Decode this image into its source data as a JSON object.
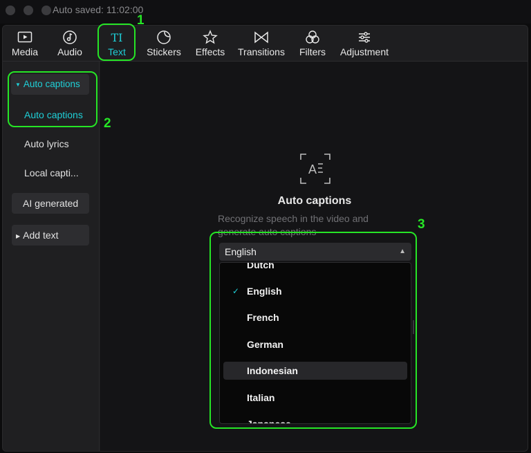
{
  "titlebar": {
    "status": "Auto saved: 11:02:00"
  },
  "tabs": [
    {
      "label": "Media",
      "icon": "media-icon"
    },
    {
      "label": "Audio",
      "icon": "audio-icon"
    },
    {
      "label": "Text",
      "icon": "text-icon",
      "active": true
    },
    {
      "label": "Stickers",
      "icon": "stickers-icon"
    },
    {
      "label": "Effects",
      "icon": "effects-icon"
    },
    {
      "label": "Transitions",
      "icon": "transitions-icon"
    },
    {
      "label": "Filters",
      "icon": "filters-icon"
    },
    {
      "label": "Adjustment",
      "icon": "adjustment-icon"
    }
  ],
  "sidebar": {
    "group_header": "Auto captions",
    "items": [
      "Auto captions",
      "Auto lyrics",
      "Local capti..."
    ],
    "ai_generated": "AI generated",
    "add_text": "Add text"
  },
  "main": {
    "icon": "auto-captions-icon",
    "title": "Auto captions",
    "description": "Recognize speech in the video and generate auto captions",
    "language_select": {
      "selected": "English",
      "options": [
        "Dutch",
        "English",
        "French",
        "German",
        "Indonesian",
        "Italian",
        "Japanese"
      ],
      "highlighted": "Indonesian"
    }
  },
  "annotations": [
    "1",
    "2",
    "3"
  ],
  "colors": {
    "accent": "#1fd0d8",
    "annotation": "#26e626",
    "background": "#141416"
  }
}
